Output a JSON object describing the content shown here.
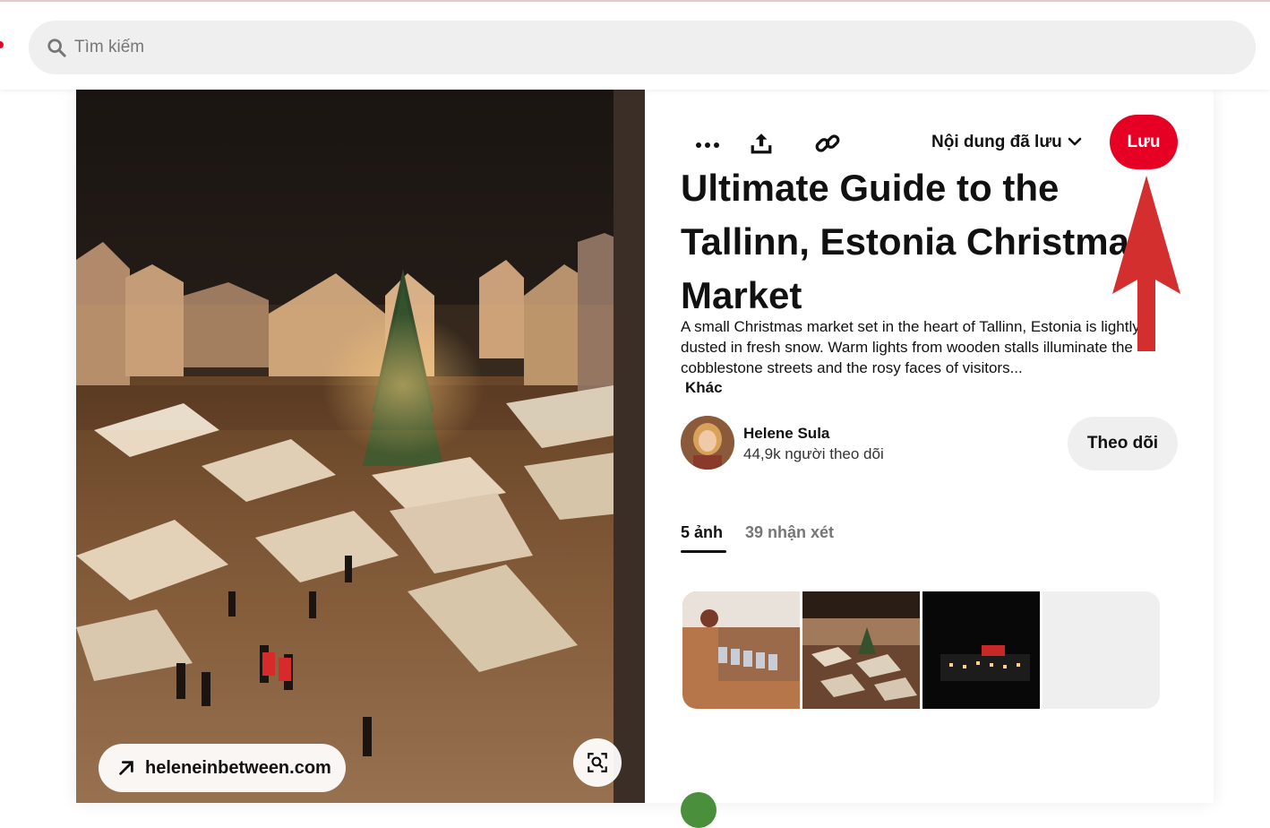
{
  "header": {
    "search_placeholder": "Tìm kiếm"
  },
  "pin": {
    "link_label": "heleneinbetween.com",
    "board_select": "Nội dung đã lưu",
    "save_label": "Lưu",
    "title": "Ultimate Guide to the Tallinn, Estonia Christmas Market",
    "description": "A small Christmas market set in the heart of Tallinn, Estonia is lightly dusted in fresh snow. Warm lights from wooden stalls illuminate the cobblestone streets and the rosy faces of visitors...",
    "more_label": "Khác"
  },
  "author": {
    "name": "Helene Sula",
    "followers": "44,9k người theo dõi",
    "follow_label": "Theo dõi"
  },
  "tabs": [
    {
      "label": "5 ảnh",
      "active": true
    },
    {
      "label": "39 nhận xét",
      "active": false
    }
  ],
  "colors": {
    "accent": "#e60023",
    "annotation_arrow": "#d32f2f"
  }
}
